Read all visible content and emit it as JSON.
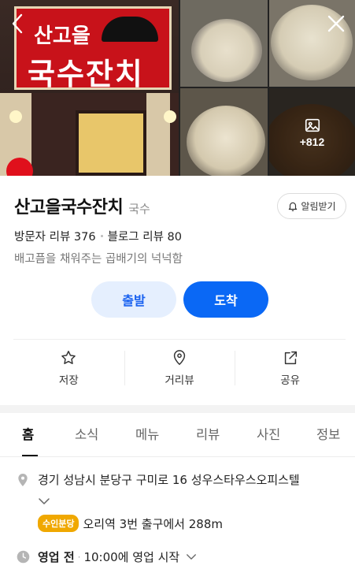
{
  "header": {
    "back_icon": "chevron-left-icon",
    "close_icon": "close-icon",
    "more_photos_icon": "image-icon",
    "more_photos_count": "+812",
    "sign_line1": "산고을",
    "sign_line2": "국수잔치"
  },
  "place": {
    "name": "산고을국수잔치",
    "category": "국수",
    "alarm_label": "알림받기",
    "visitor_reviews": "방문자 리뷰 376",
    "blog_reviews": "블로그 리뷰 80",
    "description": "배고픔을 채워주는 곱배기의 넉넉함"
  },
  "route": {
    "depart_label": "출발",
    "arrive_label": "도착"
  },
  "actions": [
    {
      "label": "저장",
      "icon": "star-icon"
    },
    {
      "label": "거리뷰",
      "icon": "map-pin-icon"
    },
    {
      "label": "공유",
      "icon": "share-icon"
    }
  ],
  "tabs": [
    {
      "label": "홈",
      "active": true
    },
    {
      "label": "소식",
      "active": false
    },
    {
      "label": "메뉴",
      "active": false
    },
    {
      "label": "리뷰",
      "active": false
    },
    {
      "label": "사진",
      "active": false
    },
    {
      "label": "정보",
      "active": false
    }
  ],
  "details": {
    "address": "경기 성남시 분당구 구미로 16 성우스타우스오피스텔",
    "station_badge": "수인분당",
    "station_text": "오리역 3번 출구에서 288m",
    "hours_status": "영업 전",
    "hours_text": "10:00에 영업 시작"
  },
  "colors": {
    "primary_blue": "#0a68f5",
    "light_blue": "#e5effe",
    "station_line": "#f0a800"
  }
}
